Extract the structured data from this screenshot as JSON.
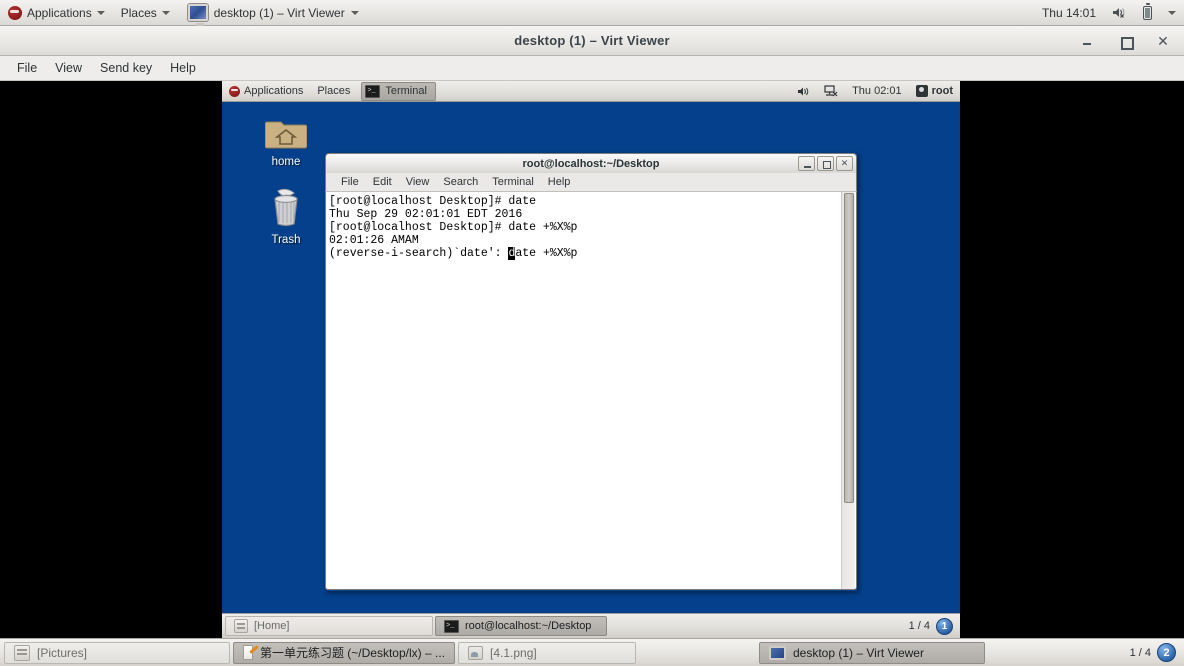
{
  "host_panel": {
    "applications": "Applications",
    "places": "Places",
    "active_window": "desktop (1) – Virt Viewer",
    "clock": "Thu 14:01",
    "icons": {
      "logo": "fedora-logo-icon",
      "volume": "volume-muted-icon",
      "battery": "battery-icon",
      "dropdown": "chevron-down-icon"
    }
  },
  "viewer_window": {
    "title": "desktop (1) – Virt Viewer",
    "menu": [
      "File",
      "View",
      "Send key",
      "Help"
    ],
    "buttons": {
      "minimize": "–",
      "maximize": "□",
      "close": "✕"
    }
  },
  "guest": {
    "panel": {
      "applications": "Applications",
      "places": "Places",
      "window_button": "Terminal",
      "clock": "Thu 02:01",
      "user": "root"
    },
    "desktop_icons": [
      {
        "label": "home",
        "icon": "home-folder-icon"
      },
      {
        "label": "Trash",
        "icon": "trash-icon"
      }
    ],
    "terminal": {
      "title": "root@localhost:~/Desktop",
      "menu": [
        "File",
        "Edit",
        "View",
        "Search",
        "Terminal",
        "Help"
      ],
      "lines": [
        "[root@localhost Desktop]# date",
        "Thu Sep 29 02:01:01 EDT 2016",
        "[root@localhost Desktop]# date +%X%p",
        "02:01:26 AMAM"
      ],
      "prompt_prefix": "(reverse-i-search)`date': ",
      "prompt_cursor_char": "d",
      "prompt_suffix": "ate +%X%p"
    },
    "taskbar": {
      "items": [
        {
          "label": "[Home]",
          "icon": "file-manager-icon",
          "active": false
        },
        {
          "label": "root@localhost:~/Desktop",
          "icon": "terminal-icon",
          "active": true
        }
      ],
      "workspace_text": "1 / 4",
      "workspace_number": "1"
    }
  },
  "host_taskbar": {
    "items": [
      {
        "label": "[Pictures]",
        "icon": "file-manager-icon",
        "active": false
      },
      {
        "label": "第一单元练习题 (~/Desktop/lx) – ...",
        "icon": "text-editor-icon",
        "active": true
      },
      {
        "label": "[4.1.png]",
        "icon": "image-viewer-icon",
        "active": false
      },
      {
        "label": "desktop (1) – Virt Viewer",
        "icon": "monitor-icon",
        "active": true
      }
    ],
    "workspace_text": "1 / 4",
    "workspace_number": "2"
  },
  "colors": {
    "desktop_blue": "#04408c",
    "panel_grey": "#e8e6e3",
    "terminal_bg": "#ffffff",
    "accent_blue": "#2b62a8"
  }
}
